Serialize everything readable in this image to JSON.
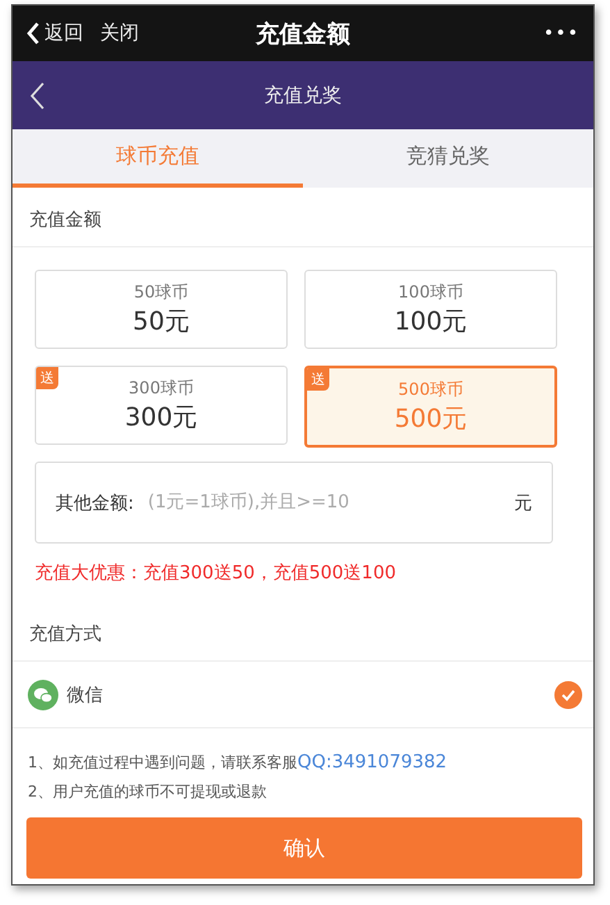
{
  "top_bar": {
    "back": "返回",
    "close": "关闭",
    "title": "充值金额",
    "more": "•••"
  },
  "header": {
    "title": "充值兑奖"
  },
  "tabs": [
    {
      "label": "球币充值",
      "selected": true
    },
    {
      "label": "竞猜兑奖",
      "selected": false
    }
  ],
  "amount_section": {
    "title": "充值金额"
  },
  "amounts": [
    {
      "coins": "50球币",
      "price": "50元",
      "selected": false
    },
    {
      "coins": "100球币",
      "price": "100元",
      "selected": false
    },
    {
      "coins": "300球币",
      "price": "300元",
      "badge": "送",
      "selected": false
    },
    {
      "coins": "500球币",
      "price": "500元",
      "badge": "送",
      "selected": true
    }
  ],
  "other_amount": {
    "label": "其他金额:",
    "placeholder": "(1元=1球币),并且>=10",
    "unit": "元"
  },
  "promo": "充值大优惠：充值300送50，充值500送100",
  "payment_section": {
    "title": "充值方式"
  },
  "payment_methods": [
    {
      "label": "微信",
      "checked": true
    }
  ],
  "notes": [
    {
      "text": "1、如充值过程中遇到问题，请联系客服",
      "link": "QQ:3491079382"
    },
    {
      "text": "2、用户充值的球币不可提现或退款"
    }
  ],
  "confirm": "确认"
}
